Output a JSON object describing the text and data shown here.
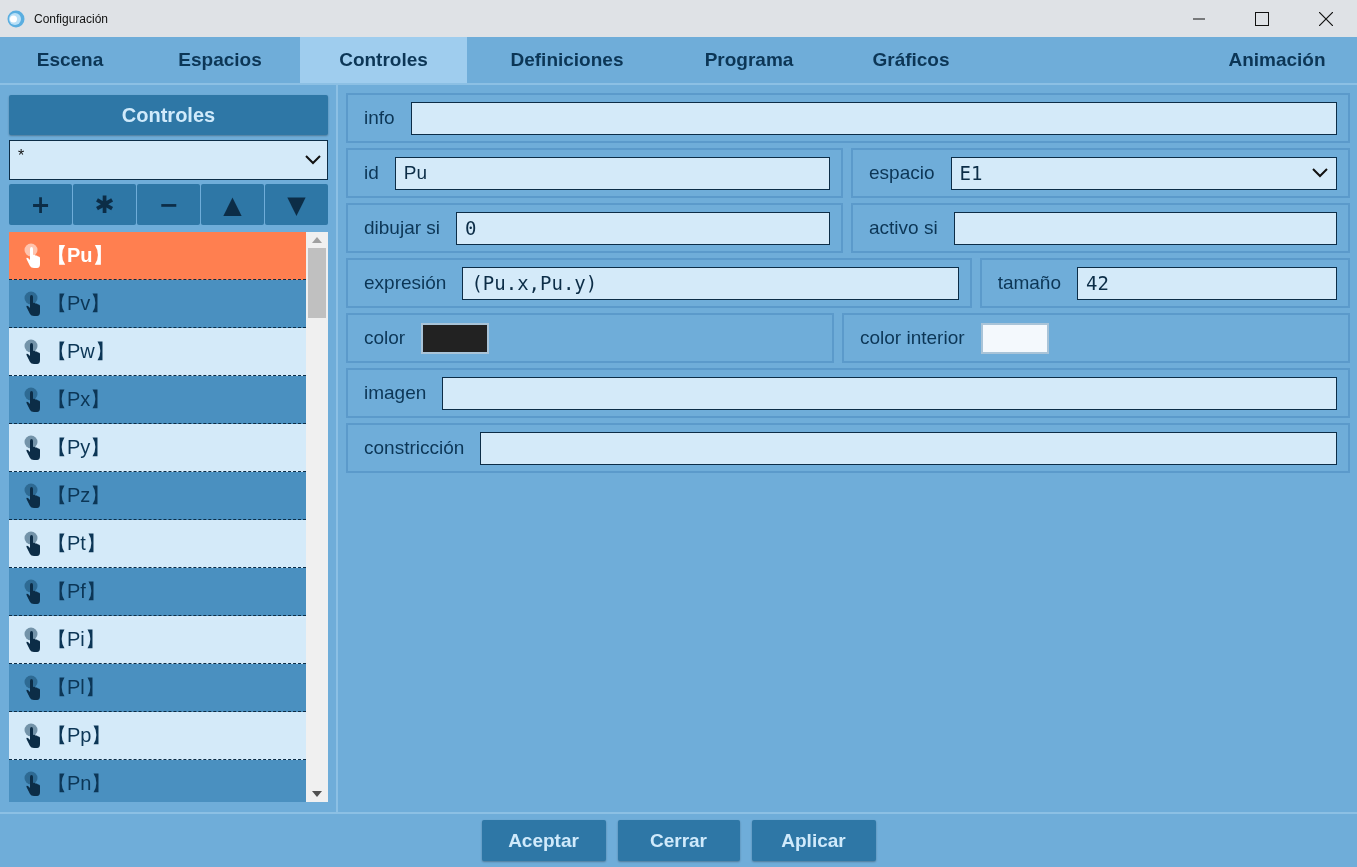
{
  "window": {
    "title": "Configuración"
  },
  "tabs": [
    {
      "label": "Escena",
      "selected": false
    },
    {
      "label": "Espacios",
      "selected": false
    },
    {
      "label": "Controles",
      "selected": true
    },
    {
      "label": "Definiciones",
      "selected": false
    },
    {
      "label": "Programa",
      "selected": false
    },
    {
      "label": "Gráficos",
      "selected": false
    },
    {
      "label": "Animación",
      "selected": false
    }
  ],
  "sidebar": {
    "title": "Controles",
    "filter": {
      "value": "*"
    },
    "tools": [
      "+",
      "✱",
      "−",
      "▲",
      "▼"
    ],
    "items": [
      {
        "label": "【Pu】",
        "selected": true
      },
      {
        "label": "【Pv】",
        "selected": false
      },
      {
        "label": "【Pw】",
        "selected": false
      },
      {
        "label": "【Px】",
        "selected": false
      },
      {
        "label": "【Py】",
        "selected": false
      },
      {
        "label": "【Pz】",
        "selected": false
      },
      {
        "label": "【Pt】",
        "selected": false
      },
      {
        "label": "【Pf】",
        "selected": false
      },
      {
        "label": "【Pi】",
        "selected": false
      },
      {
        "label": "【Pl】",
        "selected": false
      },
      {
        "label": "【Pp】",
        "selected": false
      },
      {
        "label": "【Pn】",
        "selected": false
      }
    ]
  },
  "form": {
    "rows": [
      [
        {
          "kind": "text",
          "label": "info"
        }
      ],
      [
        {
          "kind": "text",
          "label": "id",
          "value": "Pu"
        },
        {
          "kind": "select",
          "label": "espacio",
          "value": "E1"
        }
      ],
      [
        {
          "kind": "text",
          "label": "dibujar si",
          "value": "0",
          "mono": true
        },
        {
          "kind": "text",
          "label": "activo si"
        }
      ],
      [
        {
          "kind": "text",
          "label": "expresión",
          "value": "(Pu.x,Pu.y)",
          "mono": true
        },
        {
          "kind": "text",
          "label": "tamaño",
          "value": "42",
          "mono": true
        }
      ],
      [
        {
          "kind": "color",
          "label": "color",
          "color": "#222222"
        },
        {
          "kind": "color",
          "label": "color interior",
          "color": "#f4f9fd"
        }
      ],
      [
        {
          "kind": "text",
          "label": "imagen"
        }
      ],
      [
        {
          "kind": "text",
          "label": "constricción"
        }
      ]
    ]
  },
  "buttons": [
    "Aceptar",
    "Cerrar",
    "Aplicar"
  ]
}
